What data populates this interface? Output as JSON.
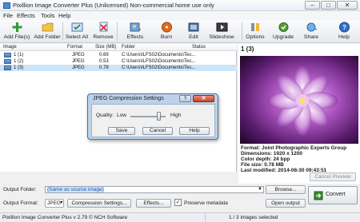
{
  "window": {
    "title": "Pixillion Image Converter Plus (Unlicensed) Non-commercial home use only",
    "min_symbol": "–",
    "max_symbol": "□",
    "close_symbol": "✕"
  },
  "menu": [
    "File",
    "Effects",
    "Tools",
    "Help"
  ],
  "toolbar": {
    "add_files": "Add File(s)",
    "add_folder": "Add Folder",
    "select_all": "Select All",
    "remove": "Remove",
    "effects": "Effects",
    "burn": "Burn",
    "edit": "Edit",
    "slideshow": "Slideshow",
    "options": "Options",
    "upgrade": "Upgrade",
    "share": "Share",
    "help": "Help"
  },
  "list": {
    "columns": [
      "Image",
      "Format",
      "Size (MB)",
      "Folder",
      "Status"
    ],
    "rows": [
      {
        "name": "1 (1)",
        "format": "JPEG",
        "size": "0.69",
        "folder": "C:\\Users\\ILFS02\\Documents\\Tes...",
        "status": ""
      },
      {
        "name": "1 (2)",
        "format": "JPEG",
        "size": "0.53",
        "folder": "C:\\Users\\ILFS02\\Documents\\Tes...",
        "status": ""
      },
      {
        "name": "1 (3)",
        "format": "JPEG",
        "size": "0.78",
        "folder": "C:\\Users\\ILFS02\\Documents\\Tes...",
        "status": ""
      }
    ]
  },
  "preview": {
    "title": "1 (3)",
    "format": "Format: Joint Photographic Experts Group",
    "dimensions": "Dimensions: 1920 x 1200",
    "color_depth": "Color depth: 24 bpp",
    "file_size": "File size: 0.78 MB",
    "last_modified": "Last modified: 2014-08-30 09:43:51",
    "cancel_preview": "Cancel Preview"
  },
  "dialog": {
    "title": "JPEG Compression Settings",
    "help_symbol": "?",
    "close_symbol": "✕",
    "quality_label": "Quality:",
    "low_label": "Low",
    "high_label": "High",
    "quality_level": 0.8,
    "save": "Save",
    "cancel": "Cancel",
    "help": "Help"
  },
  "output": {
    "folder_label": "Output Folder:",
    "folder_value": "(Same as source image)",
    "browse": "Browse...",
    "format_label": "Output Format:",
    "format_value": "JPEG",
    "compression_settings": "Compression Settings...",
    "effects": "Effects...",
    "preserve_metadata": "Preserve metadata",
    "open_output": "Open output",
    "convert": "Convert"
  },
  "status": {
    "left": "Pixillion Image Converter Plus v 2.79 © NCH Software",
    "right": "1 / 3 images selected"
  }
}
